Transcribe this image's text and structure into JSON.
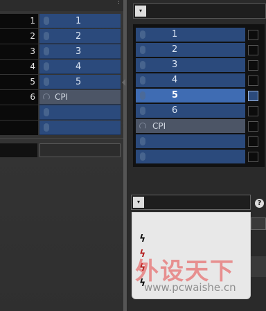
{
  "left_tracks": [
    {
      "number": "1",
      "label": "1",
      "kind": "mic"
    },
    {
      "number": "2",
      "label": "2",
      "kind": "mic"
    },
    {
      "number": "3",
      "label": "3",
      "kind": "mic"
    },
    {
      "number": "4",
      "label": "4",
      "kind": "mic"
    },
    {
      "number": "5",
      "label": "5",
      "kind": "mic"
    },
    {
      "number": "6",
      "label": "CPI",
      "kind": "cpi"
    },
    {
      "number": "",
      "label": "",
      "kind": "mic"
    },
    {
      "number": "",
      "label": "",
      "kind": "mic"
    }
  ],
  "right_list": [
    {
      "label": "1",
      "kind": "mic",
      "selected": false
    },
    {
      "label": "2",
      "kind": "mic",
      "selected": false
    },
    {
      "label": "3",
      "kind": "mic",
      "selected": false
    },
    {
      "label": "4",
      "kind": "mic",
      "selected": false
    },
    {
      "label": "5",
      "kind": "mic",
      "selected": true
    },
    {
      "label": "6",
      "kind": "mic",
      "selected": false
    },
    {
      "label": "CPI",
      "kind": "cpi",
      "selected": false
    },
    {
      "label": "",
      "kind": "mic",
      "selected": false
    },
    {
      "label": "",
      "kind": "mic",
      "selected": false
    }
  ],
  "dropdown_arrow": "▾",
  "help_icon": "?",
  "popup_items": [
    {
      "icon": "bolt-icon",
      "glyph": "ϟ",
      "color": "#111111"
    },
    {
      "icon": "bolt-icon",
      "glyph": "ϟ",
      "color": "#b42323"
    },
    {
      "icon": "bolt-icon",
      "glyph": "ϟ",
      "color": "#b42323"
    },
    {
      "icon": "bolt-icon",
      "glyph": "ϟ",
      "color": "#111111"
    }
  ],
  "watermark": {
    "cn": "外设天下",
    "url": "www.pcwaishe.cn"
  },
  "colors": {
    "track_blue": "#2b4a7c",
    "selected_blue": "#3f6cb3",
    "cpi_gray": "#4c5566"
  }
}
